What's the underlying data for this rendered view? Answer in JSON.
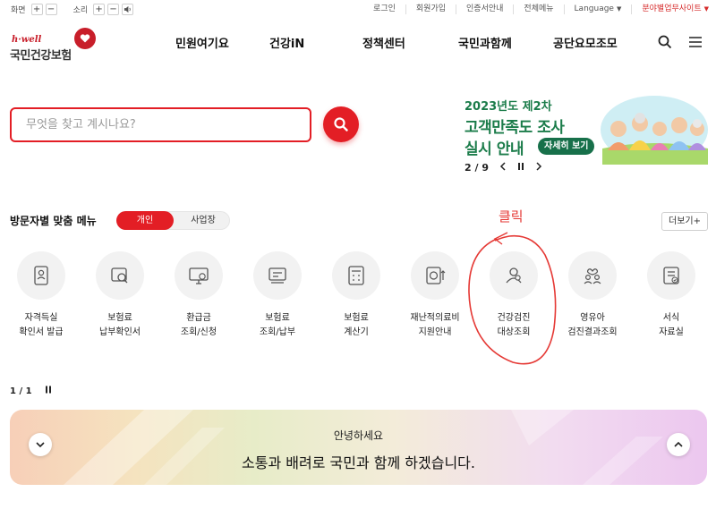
{
  "util": {
    "screen_label": "화면",
    "sound_label": "소리",
    "plus": "+",
    "minus": "−",
    "links": [
      "로그인",
      "회원가입",
      "인증서안내",
      "전체메뉴",
      "Language",
      "분야별업무사이트"
    ]
  },
  "logo": {
    "en": "h·well",
    "name": "국민건강보험"
  },
  "gnb": [
    "민원여기요",
    "건강iN",
    "정책센터",
    "국민과함께",
    "공단요모조모"
  ],
  "search": {
    "placeholder": "무엇을 찾고 계시나요?",
    "value": ""
  },
  "banner": {
    "line1": "2023년도 제2차",
    "line2": "고객만족도 조사",
    "line3": "실시 안내",
    "more": "자세히 보기",
    "page": "2 / 9"
  },
  "menu": {
    "title": "방문자별 맞춤 메뉴",
    "tabs": [
      "개인",
      "사업장"
    ],
    "more": "더보기+",
    "items": [
      {
        "icon": "id-card-icon",
        "line1": "자격득실",
        "line2": "확인서 발급"
      },
      {
        "icon": "search-document-icon",
        "line1": "보험료",
        "line2": "납부확인서"
      },
      {
        "icon": "monitor-won-icon",
        "line1": "환급금",
        "line2": "조회/신청"
      },
      {
        "icon": "payment-icon",
        "line1": "보험료",
        "line2": "조회/납부"
      },
      {
        "icon": "calculator-icon",
        "line1": "보험료",
        "line2": "계산기"
      },
      {
        "icon": "medical-support-icon",
        "line1": "재난적의료비",
        "line2": "지원안내"
      },
      {
        "icon": "checkup-user-icon",
        "line1": "건강검진",
        "line2": "대상조회"
      },
      {
        "icon": "infant-icon",
        "line1": "영유아",
        "line2": "검진결과조회"
      },
      {
        "icon": "form-icon",
        "line1": "서식",
        "line2": "자료실"
      }
    ],
    "page": "1 / 1"
  },
  "annotation": {
    "text": "클릭",
    "color": "#e53935"
  },
  "greeting": {
    "hi": "안녕하세요",
    "message": "소통과 배려로 국민과 함께 하겠습니다."
  },
  "colors": {
    "brand_red": "#e31e25",
    "banner_green": "#1b7c4a"
  }
}
